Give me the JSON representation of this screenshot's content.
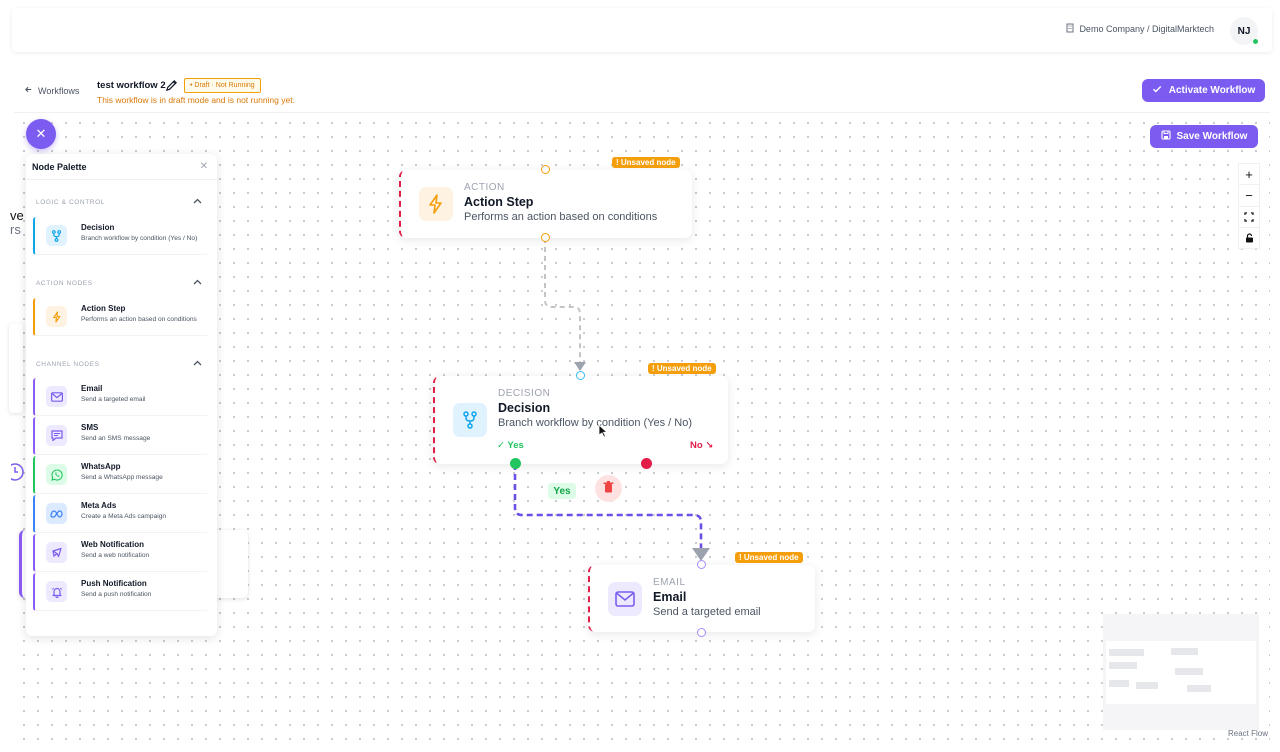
{
  "topbar": {
    "company": "Demo Company / DigitalMarktech",
    "avatar_initials": "NJ"
  },
  "header": {
    "back_label": "Workflows",
    "workflow_name": "test workflow 2",
    "status_badge": "• Draft · Not Running",
    "draft_message": "This workflow is in draft mode and is not running yet.",
    "activate_label": "Activate Workflow"
  },
  "canvas": {
    "save_label": "Save Workflow",
    "zoom_controls": [
      "plus-icon",
      "minus-icon",
      "fit-view-icon",
      "lock-icon"
    ],
    "attribution": "React Flow"
  },
  "palette": {
    "title": "Node Palette",
    "sections": [
      {
        "title": "LOGIC & CONTROL",
        "items": [
          {
            "name": "Decision",
            "desc": "Branch workflow by condition (Yes / No)",
            "icon": "branch-icon",
            "color": "#0ea5e9"
          }
        ]
      },
      {
        "title": "ACTION NODES",
        "items": [
          {
            "name": "Action Step",
            "desc": "Performs an action based on conditions",
            "icon": "lightning-icon",
            "color": "#f59e0b"
          }
        ]
      },
      {
        "title": "CHANNEL NODES",
        "items": [
          {
            "name": "Email",
            "desc": "Send a targeted email",
            "icon": "mail-icon",
            "color": "#7c5cf0"
          },
          {
            "name": "SMS",
            "desc": "Send an SMS message",
            "icon": "message-icon",
            "color": "#7c5cf0"
          },
          {
            "name": "WhatsApp",
            "desc": "Send a WhatsApp message",
            "icon": "whatsapp-icon",
            "color": "#22c55e"
          },
          {
            "name": "Meta Ads",
            "desc": "Create a Meta Ads campaign",
            "icon": "meta-icon",
            "color": "#3b82f6"
          },
          {
            "name": "Web Notification",
            "desc": "Send a web notification",
            "icon": "web-notification-icon",
            "color": "#7c5cf0"
          },
          {
            "name": "Push Notification",
            "desc": "Send a push notification",
            "icon": "bell-icon",
            "color": "#7c5cf0"
          }
        ]
      }
    ]
  },
  "nodes": {
    "action": {
      "type": "ACTION",
      "title": "Action Step",
      "desc": "Performs an action based on conditions",
      "badge": "! Unsaved node"
    },
    "decision": {
      "type": "DECISION",
      "title": "Decision",
      "desc": "Branch workflow by condition (Yes / No)",
      "badge": "! Unsaved node",
      "yes": "✓ Yes",
      "no": "No ↘"
    },
    "email": {
      "type": "EMAIL",
      "title": "Email",
      "desc": "Send a targeted email",
      "badge": "! Unsaved node"
    }
  },
  "edges": {
    "yes_label": "Yes"
  },
  "colors": {
    "accent": "#7c5cf0",
    "warning": "#f59e0b",
    "danger": "#e11d48",
    "success": "#22c55e"
  }
}
